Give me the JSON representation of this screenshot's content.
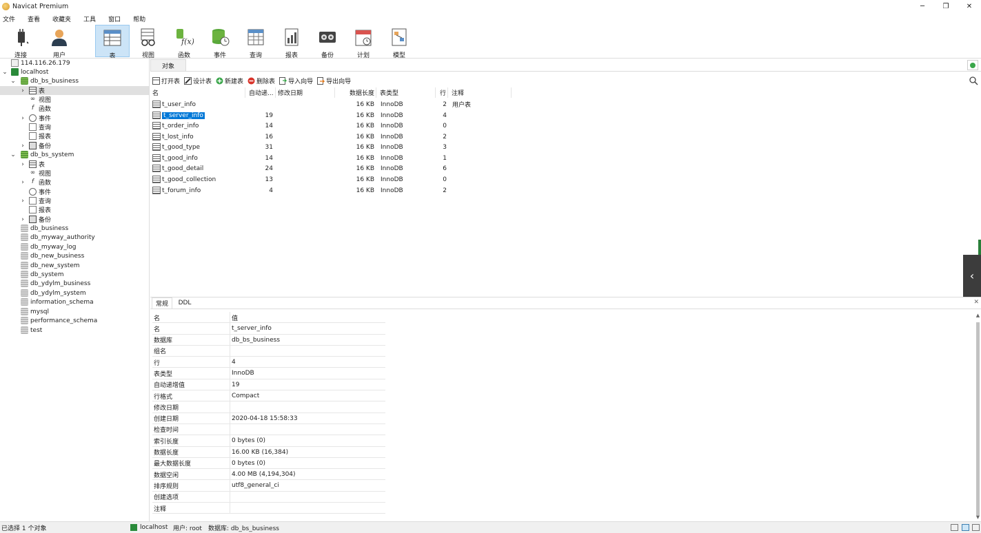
{
  "window": {
    "title": "Navicat Premium",
    "controls": {
      "minimize": "─",
      "restore": "❐",
      "close": "✕"
    }
  },
  "menu": [
    "文件",
    "查看",
    "收藏夹",
    "工具",
    "窗口",
    "帮助"
  ],
  "toolbar": {
    "connect": "连接",
    "user": "用户",
    "table": "表",
    "view": "视图",
    "function": "函数",
    "event": "事件",
    "query": "查询",
    "report": "报表",
    "backup": "备份",
    "schedule": "计划",
    "model": "模型"
  },
  "tree": {
    "server": "114.116.26.179",
    "connection": "localhost",
    "db1": {
      "name": "db_bs_business",
      "children": [
        "表",
        "视图",
        "函数",
        "事件",
        "查询",
        "报表",
        "备份"
      ]
    },
    "db2": {
      "name": "db_bs_system",
      "children": [
        "表",
        "视图",
        "函数",
        "事件",
        "查询",
        "报表",
        "备份"
      ]
    },
    "others": [
      "db_business",
      "db_myway_authority",
      "db_myway_log",
      "db_new_business",
      "db_new_system",
      "db_system",
      "db_ydylm_business",
      "db_ydylm_system",
      "information_schema",
      "mysql",
      "performance_schema",
      "test"
    ]
  },
  "object_tab": "对象",
  "object_toolbar": {
    "open": "打开表",
    "design": "设计表",
    "new": "新建表",
    "delete": "删除表",
    "import": "导入向导",
    "export": "导出向导"
  },
  "columns": {
    "name": "名",
    "autoinc": "自动递...",
    "modified": "修改日期",
    "datalen": "数据长度",
    "engine": "表类型",
    "rows": "行",
    "comment": "注释"
  },
  "tables": [
    {
      "name": "t_user_info",
      "autoinc": "",
      "datalen": "16 KB",
      "engine": "InnoDB",
      "rows": "2",
      "comment": "用户表"
    },
    {
      "name": "t_server_info",
      "autoinc": "19",
      "datalen": "16 KB",
      "engine": "InnoDB",
      "rows": "4",
      "comment": ""
    },
    {
      "name": "t_order_info",
      "autoinc": "14",
      "datalen": "16 KB",
      "engine": "InnoDB",
      "rows": "0",
      "comment": ""
    },
    {
      "name": "t_lost_info",
      "autoinc": "16",
      "datalen": "16 KB",
      "engine": "InnoDB",
      "rows": "2",
      "comment": ""
    },
    {
      "name": "t_good_type",
      "autoinc": "31",
      "datalen": "16 KB",
      "engine": "InnoDB",
      "rows": "3",
      "comment": ""
    },
    {
      "name": "t_good_info",
      "autoinc": "14",
      "datalen": "16 KB",
      "engine": "InnoDB",
      "rows": "1",
      "comment": ""
    },
    {
      "name": "t_good_detail",
      "autoinc": "24",
      "datalen": "16 KB",
      "engine": "InnoDB",
      "rows": "6",
      "comment": ""
    },
    {
      "name": "t_good_collection",
      "autoinc": "13",
      "datalen": "16 KB",
      "engine": "InnoDB",
      "rows": "0",
      "comment": ""
    },
    {
      "name": "t_forum_info",
      "autoinc": "4",
      "datalen": "16 KB",
      "engine": "InnoDB",
      "rows": "2",
      "comment": ""
    }
  ],
  "info_tabs": {
    "general": "常规",
    "ddl": "DDL",
    "close": "✕"
  },
  "properties": {
    "header": {
      "k": "名",
      "v": "值"
    },
    "rows": [
      {
        "k": "名",
        "v": "t_server_info"
      },
      {
        "k": "数据库",
        "v": "db_bs_business"
      },
      {
        "k": "组名",
        "v": ""
      },
      {
        "k": "行",
        "v": "4"
      },
      {
        "k": "表类型",
        "v": "InnoDB"
      },
      {
        "k": "自动递增值",
        "v": "19"
      },
      {
        "k": "行格式",
        "v": "Compact"
      },
      {
        "k": "修改日期",
        "v": ""
      },
      {
        "k": "创建日期",
        "v": "2020-04-18 15:58:33"
      },
      {
        "k": "检查时间",
        "v": ""
      },
      {
        "k": "索引长度",
        "v": "0 bytes (0)"
      },
      {
        "k": "数据长度",
        "v": "16.00 KB (16,384)"
      },
      {
        "k": "最大数据长度",
        "v": "0 bytes (0)"
      },
      {
        "k": "数据空闲",
        "v": "4.00 MB (4,194,304)"
      },
      {
        "k": "排序规则",
        "v": "utf8_general_ci"
      },
      {
        "k": "创建选项",
        "v": ""
      },
      {
        "k": "注释",
        "v": ""
      }
    ]
  },
  "status": {
    "selection": "已选择 1 个对象",
    "connection": "localhost",
    "user": "用户: root",
    "database": "数据库: db_bs_business"
  }
}
